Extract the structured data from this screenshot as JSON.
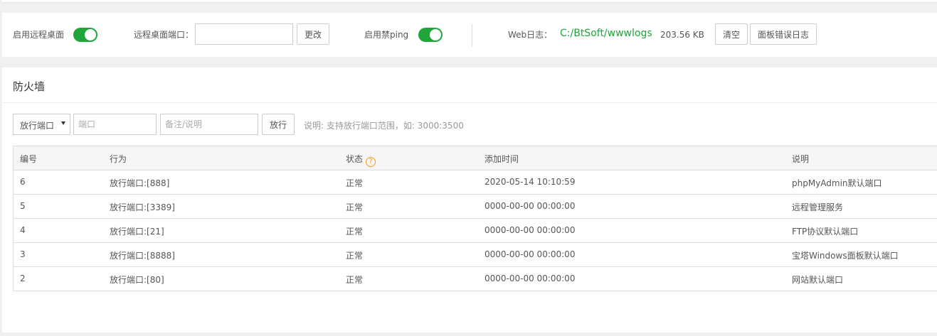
{
  "settings": {
    "remote_desktop_label": "启用远程桌面",
    "remote_port_label": "远程桌面端口：",
    "remote_port_value": "",
    "change_button": "更改",
    "ping_label": "启用禁ping",
    "web_log_label": "Web日志：",
    "web_log_path": "C:/BtSoft/wwwlogs",
    "web_log_size": "203.56 KB",
    "clear_button": "清空",
    "panel_error_log_button": "面板错误日志"
  },
  "firewall": {
    "title": "防火墙",
    "type_select": "放行端口",
    "port_placeholder": "端口",
    "note_placeholder": "备注/说明",
    "allow_button": "放行",
    "hint": "说明: 支持放行端口范围，如: 3000:3500",
    "columns": {
      "id": "编号",
      "action": "行为",
      "status": "状态",
      "added_time": "添加时间",
      "description": "说明"
    },
    "rows": [
      {
        "id": "6",
        "action": "放行端口:[888]",
        "status": "正常",
        "time": "2020-05-14 10:10:59",
        "note": "phpMyAdmin默认端口"
      },
      {
        "id": "5",
        "action": "放行端口:[3389]",
        "status": "正常",
        "time": "0000-00-00 00:00:00",
        "note": "远程管理服务"
      },
      {
        "id": "4",
        "action": "放行端口:[21]",
        "status": "正常",
        "time": "0000-00-00 00:00:00",
        "note": "FTP协议默认端口"
      },
      {
        "id": "3",
        "action": "放行端口:[8888]",
        "status": "正常",
        "time": "0000-00-00 00:00:00",
        "note": "宝塔Windows面板默认端口"
      },
      {
        "id": "2",
        "action": "放行端口:[80]",
        "status": "正常",
        "time": "0000-00-00 00:00:00",
        "note": "网站默认端口"
      }
    ]
  }
}
